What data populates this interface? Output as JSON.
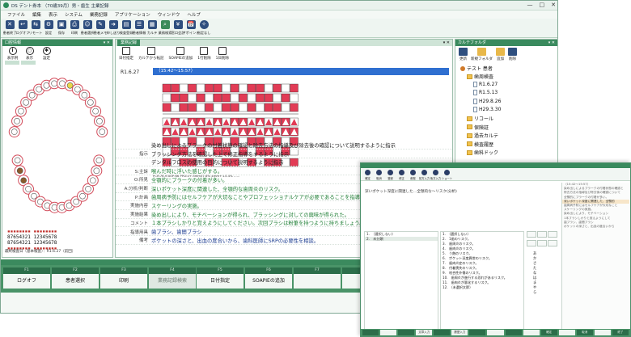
{
  "window": {
    "title": "DS デント券本 （70歳39月）男・歯生 主業記録",
    "controls": [
      "—",
      "□",
      "✕"
    ]
  },
  "menu": [
    "ファイル",
    "編集",
    "表示",
    "システム",
    "業務記録",
    "アプリケーション",
    "ウィンドウ",
    "ヘルプ"
  ],
  "toolbar": [
    {
      "label": "患者終了",
      "icon": "close-patient-icon"
    },
    {
      "label": "ログオフ",
      "icon": "logoff-icon"
    },
    {
      "label": "リモート",
      "icon": "remote-icon"
    },
    {
      "label": "設定",
      "icon": "settings-icon"
    },
    {
      "label": "保存",
      "icon": "save-icon"
    },
    {
      "label": "印刷",
      "icon": "print-icon"
    },
    {
      "label": "患者選択",
      "icon": "patient-select-icon"
    },
    {
      "label": "患者メモ",
      "icon": "patient-memo-icon"
    },
    {
      "label": "申し送り",
      "icon": "handover-icon"
    },
    {
      "label": "検査登録",
      "icon": "exam-register-icon"
    },
    {
      "label": "患者情報",
      "icon": "patient-info-icon"
    },
    {
      "label": "カルテ",
      "icon": "chart-icon"
    },
    {
      "label": "業務検索",
      "icon": "task-search-icon"
    },
    {
      "label": "窓口会計",
      "icon": "cashier-icon"
    },
    {
      "label": "アポイント",
      "icon": "appointment-icon"
    },
    {
      "label": "指定なし",
      "icon": "none-icon"
    }
  ],
  "left_panel": {
    "header": "口腔情報",
    "tools": [
      "表示例",
      "表示",
      "設定"
    ],
    "upper_numbers": "87654321 12345678",
    "lower_numbers": "87654321 12345678",
    "footer": "最終検査日（基本検査）：R1.6.27（前回）"
  },
  "center_panel": {
    "tab": "業務記録",
    "tools": [
      "日付指定",
      "カルテから転記",
      "SOAPIEの追加",
      "1行削除",
      "1日削除"
    ],
    "record_date": "R1.6.27",
    "time_range": "（15:42～15:57）",
    "probe_caption": "PCR:76.9 BOP:66 PPD:4+:3mm57.6% 4mm+:15.4% ……",
    "rows": [
      {
        "label": "",
        "text": "染め出しによるプラークの付着状態の確認と除去方法の指導及び除去後の確認について説明するように指示",
        "style": "plain"
      },
      {
        "label": "指示",
        "text": "ブラッシング方法を確認した上で修正指導をするように指示",
        "style": "plain"
      },
      {
        "label": "",
        "text": "デンタルフロスの使用の目的について説明するように指示",
        "style": "plain"
      },
      {
        "label": "S:主訴",
        "text": "喉んだ時に浮いた感じがする。",
        "style": "green"
      },
      {
        "label": "O:所見",
        "text": "全顎的にプラークの付着が多い。",
        "style": "green"
      },
      {
        "label": "A:分析/判断",
        "text": "深いポケット深度に関連した、全顎的な歯周炎のリスク。",
        "style": "green"
      },
      {
        "label": "P:計画",
        "text": "歯周病予防にはセルフケアが大切なことやプロフェッショナルケアが必要であることを指導。",
        "style": "green"
      },
      {
        "label": "実施内容",
        "text": "スケーリングの実施。",
        "style": "green"
      },
      {
        "label": "実施結果",
        "text": "染め出しにより、モチベーションが得られ、ブラッシングに対しての興味が得られた。",
        "style": "green"
      },
      {
        "label": "コメント",
        "text": "１本ブラシしかりと覚えようにしてください。次回ブラシは粉筆を持つように持ちましょう。",
        "style": "green"
      },
      {
        "label": "指導用具",
        "text": "歯ブラシ、歯間ブラシ",
        "style": "blue"
      },
      {
        "label": "備考",
        "text": "ポケットの深さと、出血の度合いから、歯科医師にSRPの必要性を相談。",
        "style": "blue"
      }
    ]
  },
  "right_panel": {
    "header": "カルテフォルダ",
    "tools": [
      "更新",
      "新規フォルダ",
      "追加",
      "削除"
    ],
    "tree": [
      {
        "label": "テスト 患者",
        "level": 0,
        "icon": "person-icon"
      },
      {
        "label": "歯周検査",
        "level": 1,
        "icon": "folder-icon"
      },
      {
        "label": "R1.6.27",
        "level": 2,
        "icon": "document-icon"
      },
      {
        "label": "R1.5.13",
        "level": 2,
        "icon": "document-icon"
      },
      {
        "label": "H29.8.26",
        "level": 2,
        "icon": "document-icon"
      },
      {
        "label": "H29.3.30",
        "level": 2,
        "icon": "document-icon"
      },
      {
        "label": "リコール",
        "level": 1,
        "icon": "folder-icon"
      },
      {
        "label": "保険証",
        "level": 1,
        "icon": "folder-icon"
      },
      {
        "label": "過去カルテ",
        "level": 1,
        "icon": "folder-icon"
      },
      {
        "label": "検査履歴",
        "level": 1,
        "icon": "folder-icon"
      },
      {
        "label": "歯科ドック",
        "level": 1,
        "icon": "folder-icon"
      }
    ]
  },
  "function_keys": [
    {
      "key": "F1",
      "label": "ログオフ",
      "disabled": false
    },
    {
      "key": "F2",
      "label": "患者選択",
      "disabled": false
    },
    {
      "key": "F3",
      "label": "印刷",
      "disabled": false
    },
    {
      "key": "F4",
      "label": "業務記録検索",
      "disabled": true
    },
    {
      "key": "F5",
      "label": "日付指定",
      "disabled": false
    },
    {
      "key": "F6",
      "label": "SOAPIEの追加",
      "disabled": false
    },
    {
      "key": "F7",
      "label": "",
      "disabled": false
    },
    {
      "key": "F8",
      "label": "",
      "disabled": false
    }
  ],
  "overlay": {
    "tools": [
      "確定",
      "取消",
      "登録",
      "修正",
      "削除",
      "前方入力",
      "後方入力",
      "ショート"
    ],
    "phrase": "深いポケット深度に関連した…全顎的な～リスク(分析)",
    "left_list": [
      "1.　（選択しない）",
      "2.　未分類"
    ],
    "mid_list": [
      "1.　（選択しない）",
      "2.　1歯のリスク。",
      "3.　歯周炎のリスク。",
      "4.　歯肉炎のリスク。",
      "5.　う蝕のリスク。",
      "6.　ポケット深度異常のリスク。",
      "7.　歯肉炎症のリスク。",
      "8.　付着喪失のリスク。",
      "9.　咬合性外傷のリスク。",
      "10.　歯周炎が進行する恐れがあるリスク。",
      "11.　歯肉炎が悪化するリスク。",
      "12.　（未選択文節）"
    ],
    "kana_list": [
      "あ",
      "か",
      "さ",
      "た",
      "な",
      "は",
      "ま",
      "や",
      "ら"
    ],
    "preview": [
      "（15:42～15:57）",
      "染め出しによるプラークの付着状態の確認と",
      "除去方法の指導及び除去後の確認について",
      "全顎的にプラークの付着が多い。",
      "深いポケット深度に関連した、全顎的",
      "歯周病予防にはセルフケアが大切なこと",
      "スケーリングの実施。",
      "染め出しにより、モチベーション",
      "1本ブラシしかりと覚えようにして",
      "歯ブラシ、歯間ブラシ",
      "ポケットの深さと、出血の度合いから"
    ],
    "fkeys": [
      "",
      "",
      "",
      "文章入力",
      "",
      "履歴入力",
      "",
      "",
      "",
      "",
      "確定",
      "",
      "取消",
      "",
      "終了"
    ]
  }
}
